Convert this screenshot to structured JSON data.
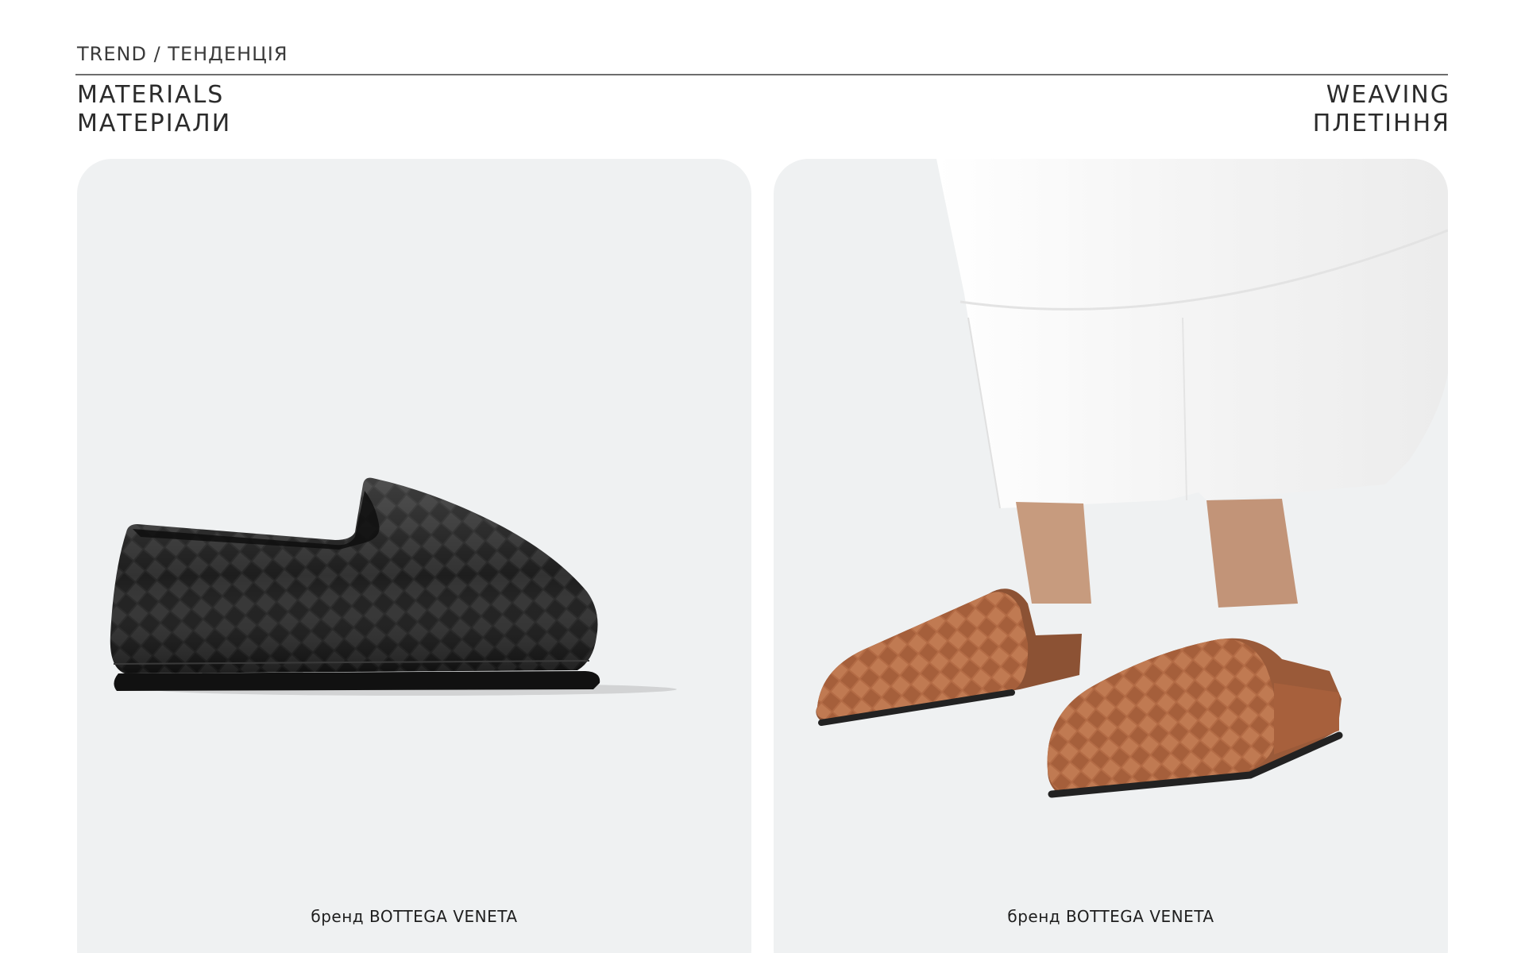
{
  "header": {
    "breadcrumb": "TREND / ТЕНДЕНЦІЯ",
    "left_title": [
      "MATERIALS",
      "МАТЕРІАЛИ"
    ],
    "right_title": [
      "WEAVING",
      "ПЛЕТІННЯ"
    ]
  },
  "cards": [
    {
      "caption": "бренд BOTTEGA VENETA",
      "image_subject": "black woven leather loafer"
    },
    {
      "caption": "бренд BOTTEGA VENETA",
      "image_subject": "tan woven suede clog mules worn with white trousers"
    }
  ],
  "colors": {
    "card_bg": "#eff1f2",
    "rule": "#6d6d6d",
    "leather_black": "#1b1b1b",
    "suede_tan": "#b86f48",
    "trouser_white": "#fafafa"
  }
}
